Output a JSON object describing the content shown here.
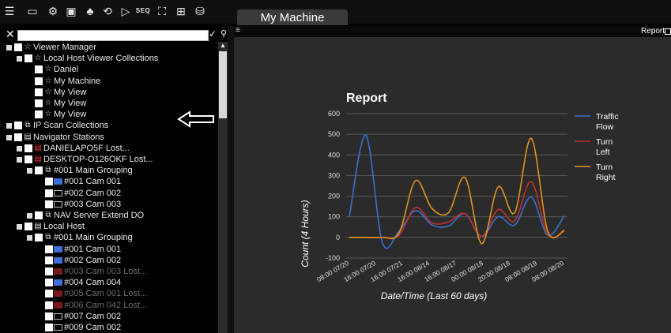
{
  "toolbar": {
    "icons": [
      "menu-icon",
      "monitor-icon",
      "settings-icon",
      "screen-share-icon",
      "network-icon",
      "refresh-icon",
      "play-icon",
      "sequence-icon",
      "map-icon",
      "layout-icon",
      "database-icon"
    ],
    "seq_label": "SEQ"
  },
  "tab": {
    "title": "My Machine"
  },
  "search": {
    "value": "",
    "placeholder": ""
  },
  "tree": [
    {
      "label": "Viewer Manager",
      "level": 0,
      "expander": true,
      "icon": "star-icon"
    },
    {
      "label": "Local Host Viewer Collections",
      "level": 1,
      "expander": true,
      "icon": "star-icon"
    },
    {
      "label": "Daniel",
      "level": 2,
      "expander": false,
      "icon": "star-icon"
    },
    {
      "label": "My Machine",
      "level": 2,
      "expander": false,
      "icon": "star-icon"
    },
    {
      "label": "My View",
      "level": 2,
      "expander": false,
      "icon": "star-icon"
    },
    {
      "label": "My View",
      "level": 2,
      "expander": false,
      "icon": "star-icon"
    },
    {
      "label": "My View",
      "level": 2,
      "expander": false,
      "icon": "star-icon"
    },
    {
      "label": "IP Scan Collections",
      "level": 0,
      "expander": true,
      "icon": "group-icon"
    },
    {
      "label": "Navigator Stations",
      "level": 0,
      "expander": true,
      "icon": "server-icon"
    },
    {
      "label": "DANIELAPO5F Lost...",
      "level": 1,
      "expander": true,
      "icon": "server-lost-icon"
    },
    {
      "label": "DESKTOP-O126OKF Lost...",
      "level": 1,
      "expander": true,
      "icon": "server-lost-icon"
    },
    {
      "label": "#001 Main Grouping",
      "level": 2,
      "expander": true,
      "icon": "group-icon"
    },
    {
      "label": "#001 Cam 001",
      "level": 3,
      "expander": false,
      "icon": "camera-blue-icon"
    },
    {
      "label": "#002 Cam 002",
      "level": 3,
      "expander": false,
      "icon": "camera-icon"
    },
    {
      "label": "#003 Cam 003",
      "level": 3,
      "expander": false,
      "icon": "camera-icon"
    },
    {
      "label": "NAV Server Extend DO",
      "level": 2,
      "expander": true,
      "icon": "group-icon"
    },
    {
      "label": "Local Host",
      "level": 1,
      "expander": true,
      "icon": "server-icon"
    },
    {
      "label": "#001 Main Grouping",
      "level": 2,
      "expander": true,
      "icon": "group-icon"
    },
    {
      "label": "#001 Cam 001",
      "level": 3,
      "expander": false,
      "icon": "camera-blue-icon"
    },
    {
      "label": "#002 Cam 002",
      "level": 3,
      "expander": false,
      "icon": "camera-blue-icon"
    },
    {
      "label": "#003 Cam 003 Lost...",
      "level": 3,
      "expander": false,
      "icon": "camera-lost-icon",
      "dim": true
    },
    {
      "label": "#004 Cam 004",
      "level": 3,
      "expander": false,
      "icon": "camera-blue-icon"
    },
    {
      "label": "#005 Cam 001 Lost...",
      "level": 3,
      "expander": false,
      "icon": "camera-lost-icon",
      "dim": true
    },
    {
      "label": "#006 Cam 042 Lost...",
      "level": 3,
      "expander": false,
      "icon": "camera-lost-icon",
      "dim": true
    },
    {
      "label": "#007 Cam 002",
      "level": 3,
      "expander": false,
      "icon": "camera-icon"
    },
    {
      "label": "#009 Cam 002",
      "level": 3,
      "expander": false,
      "icon": "camera-icon"
    }
  ],
  "right_panel": {
    "menu_glyph": "≡",
    "title": "Report"
  },
  "colors": {
    "traffic": "#3a6fd0",
    "left": "#c0302a",
    "right": "#e0941a",
    "grid": "#5a5a5a"
  },
  "chart_data": {
    "type": "line",
    "title": "Report",
    "xlabel": "Date/Time (Last 60 days)",
    "ylabel": "Count (4 Hours)",
    "ylim": [
      -100,
      600
    ],
    "yticks": [
      -100,
      0,
      100,
      200,
      300,
      400,
      500,
      600
    ],
    "x": [
      "08:00 07/20",
      "16:00 07/20",
      "16:00 07/21",
      "16:00 08/14",
      "16:00 08/17",
      "00:00 08/18",
      "20:00 08/18",
      "08:00 08/19",
      "08:00 08/20"
    ],
    "legend_position": "right",
    "series": [
      {
        "name": "Traffic Flow",
        "legend": [
          "Traffic",
          "Flow"
        ],
        "color": "#3a6fd0",
        "values": [
          100,
          495,
          -25,
          30,
          130,
          60,
          55,
          115,
          5,
          100,
          60,
          195,
          10,
          105
        ]
      },
      {
        "name": "Turn Left",
        "legend": [
          "Turn",
          "Left"
        ],
        "color": "#c0302a",
        "values": [
          0,
          0,
          0,
          10,
          145,
          70,
          75,
          115,
          5,
          135,
          80,
          270,
          15,
          30
        ]
      },
      {
        "name": "Turn Right",
        "legend": [
          "Turn",
          "Right"
        ],
        "color": "#e0941a",
        "values": [
          0,
          0,
          0,
          20,
          275,
          140,
          120,
          290,
          -30,
          245,
          120,
          480,
          30,
          35
        ]
      }
    ]
  }
}
